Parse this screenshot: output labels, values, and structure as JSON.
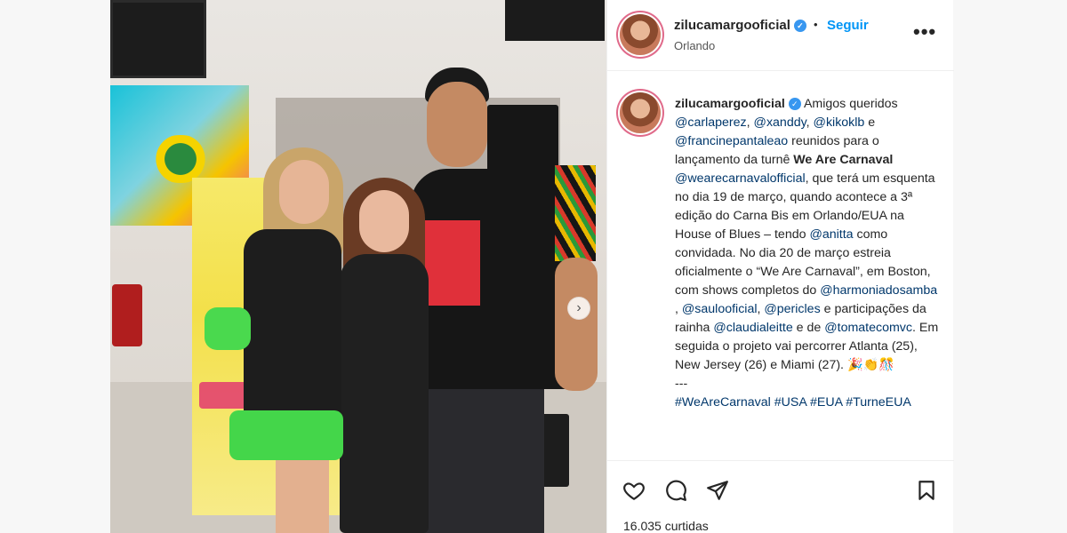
{
  "post": {
    "username": "zilucamargooficial",
    "verified_badge": "✓",
    "separator": "•",
    "follow_label": "Seguir",
    "location": "Orlando",
    "more_icon": "more-options-icon",
    "more_label": "•••"
  },
  "caption": {
    "username": "zilucamargooficial",
    "s1": " Amigos queridos ",
    "m1": "@carlaperez",
    "s2": ", ",
    "m2": "@xanddy",
    "s3": ", ",
    "m3": "@kikoklb",
    "s4": " e ",
    "m4": "@francinepantaleao",
    "s5": " reunidos para o lançamento da turnê ",
    "b1": "We Are Carnaval",
    "s6": " ",
    "m5": "@wearecarnavalofficial",
    "s7": ", que terá um esquenta no dia 19 de março, quando acontece a 3ª edição do Carna Bis em Orlando/EUA na House of Blues – tendo ",
    "m6": "@anitta",
    "s8": " como convidada. No dia 20 de março estreia oficialmente o “We Are Carnaval”, em Boston, com shows completos do ",
    "m7": "@harmoniadosamba",
    "s9": " , ",
    "m8": "@saulooficial",
    "s10": ", ",
    "m9": "@pericles",
    "s11": " e participações da rainha ",
    "m10": "@claudialeitte",
    "s12": " e de ",
    "m11": "@tomatecomvc",
    "s13": ". Em seguida o projeto vai percorrer Atlanta (25), New Jersey (26) e Miami (27). 🎉👏🎊",
    "dashes": "---",
    "hashtags": [
      "#WeAreCarnaval",
      "#USA",
      "#EUA",
      "#TurneEUA"
    ]
  },
  "actions": {
    "like_icon": "heart-icon",
    "comment_icon": "comment-icon",
    "share_icon": "paper-plane-icon",
    "save_icon": "bookmark-icon",
    "likes_text": "16.035 curtidas"
  },
  "carousel": {
    "next_label": "›"
  }
}
